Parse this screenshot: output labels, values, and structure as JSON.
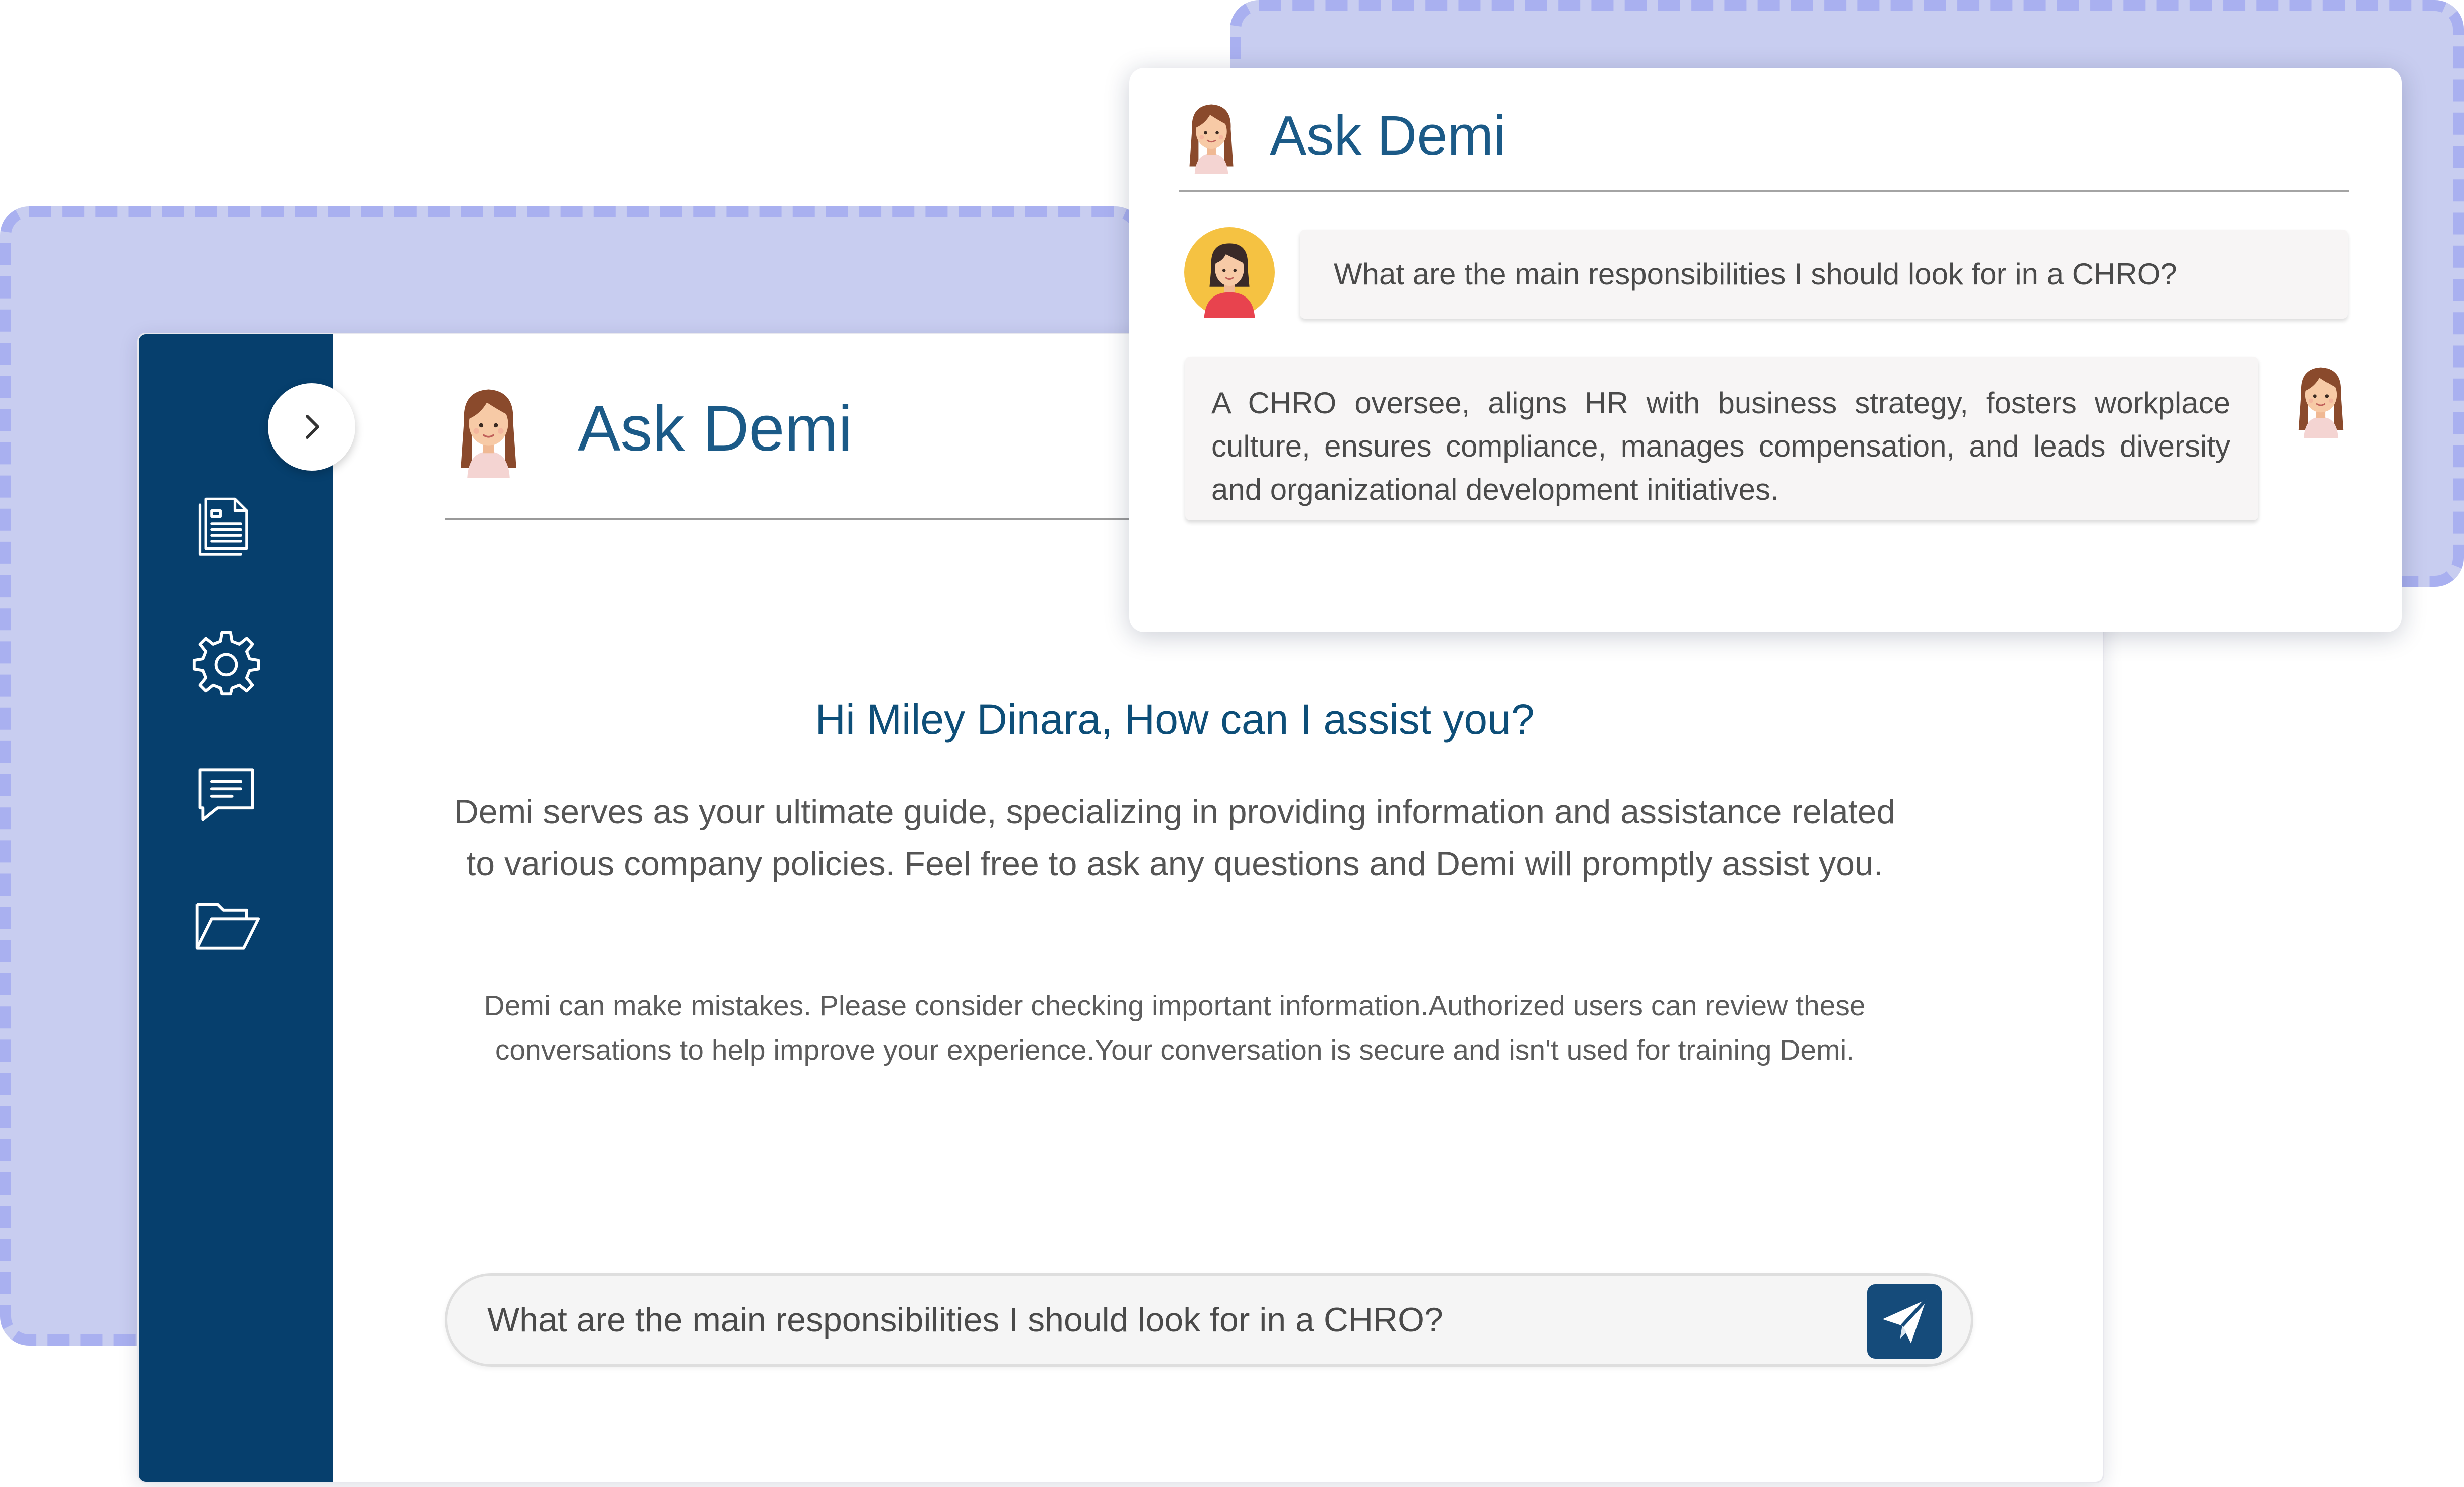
{
  "app": {
    "title": "Ask Demi"
  },
  "sidebar": {
    "items": [
      {
        "icon": "document-list-icon"
      },
      {
        "icon": "gear-icon"
      },
      {
        "icon": "chat-bubble-icon"
      },
      {
        "icon": "folder-open-icon"
      }
    ],
    "expand_icon": "chevron-right-icon"
  },
  "welcome": {
    "greeting": "Hi Miley Dinara, How can I assist you?",
    "intro": "Demi serves as your ultimate guide, specializing in providing information and assistance related to various company policies. Feel free to ask any questions and Demi will promptly assist you.",
    "disclaimer": "Demi can make mistakes. Please consider checking important information.Authorized users can review these conversations to help improve your experience.Your conversation is secure and isn't used for training Demi."
  },
  "chat_input": {
    "value": "What are the main responsibilities I should look for in a CHRO?",
    "send_icon": "paper-plane-icon"
  },
  "popup": {
    "title": "Ask Demi",
    "messages": [
      {
        "role": "user",
        "text": "What are the main responsibilities I should look for in a CHRO?"
      },
      {
        "role": "assistant",
        "text": "A CHRO oversee, aligns HR with business strategy, fosters workplace culture, ensures compliance, manages compensation, and leads diversity and organizational development initiatives."
      }
    ]
  },
  "colors": {
    "sidebar": "#063f6d",
    "accent_text": "#1b5a87",
    "decor_panel": "#c8cdf0",
    "decor_dash": "#a9b0f0",
    "send_button": "#154b7a"
  }
}
